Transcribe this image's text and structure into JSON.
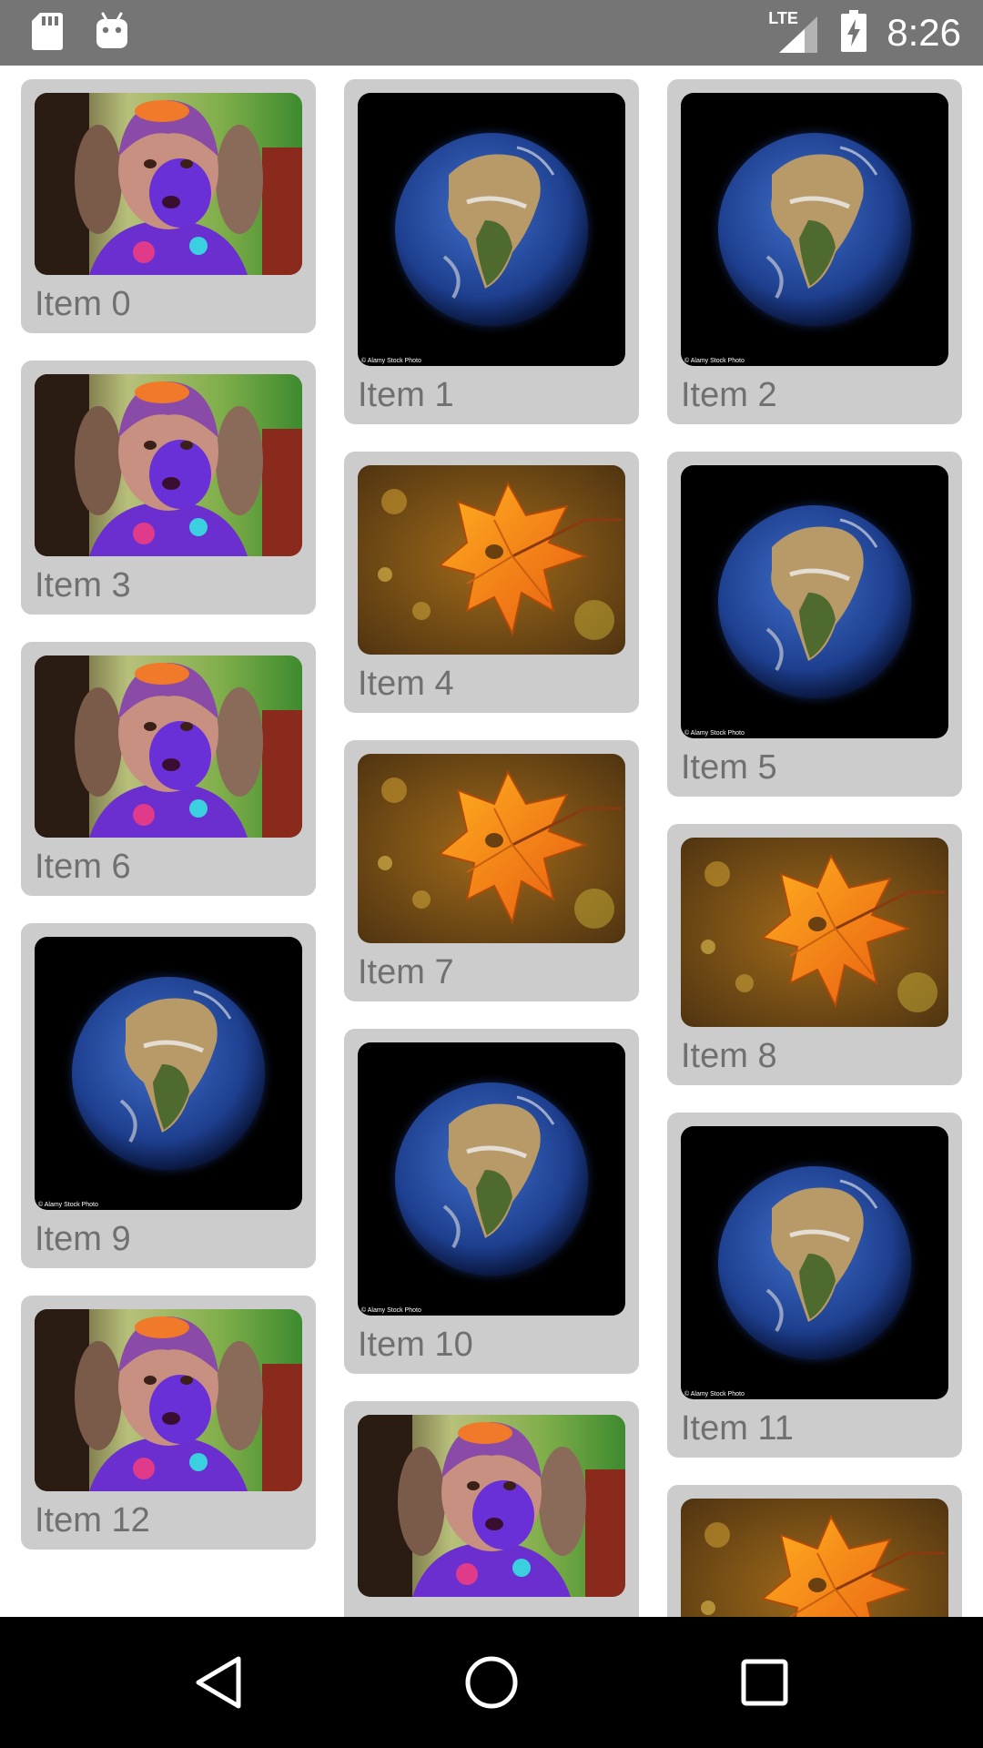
{
  "status_bar": {
    "time": "8:26",
    "network": "LTE",
    "background": "#757575"
  },
  "grid": {
    "card_color": "#cccccc",
    "label_color": "#707070",
    "columns": [
      [
        {
          "label": "Item 0",
          "image": "girl-photo"
        },
        {
          "label": "Item 3",
          "image": "girl-photo"
        },
        {
          "label": "Item 6",
          "image": "girl-photo"
        },
        {
          "label": "Item 9",
          "image": "earth-photo",
          "credit": "© Alamy Stock Photo"
        },
        {
          "label": "Item 12",
          "image": "girl-photo"
        }
      ],
      [
        {
          "label": "Item 1",
          "image": "earth-photo",
          "credit": "© Alamy Stock Photo"
        },
        {
          "label": "Item 4",
          "image": "leaf-photo"
        },
        {
          "label": "Item 7",
          "image": "leaf-photo"
        },
        {
          "label": "Item 10",
          "image": "earth-photo",
          "credit": "© Alamy Stock Photo"
        },
        {
          "label": "",
          "image": "girl-photo"
        }
      ],
      [
        {
          "label": "Item 2",
          "image": "earth-photo",
          "credit": "© Alamy Stock Photo"
        },
        {
          "label": "Item 5",
          "image": "earth-photo",
          "credit": "© Alamy Stock Photo"
        },
        {
          "label": "Item 8",
          "image": "leaf-photo"
        },
        {
          "label": "Item 11",
          "image": "earth-photo",
          "credit": "© Alamy Stock Photo"
        },
        {
          "label": "",
          "image": "leaf-photo"
        }
      ]
    ]
  },
  "nav_bar": {
    "buttons": [
      "back-icon",
      "home-icon",
      "recents-icon"
    ]
  }
}
